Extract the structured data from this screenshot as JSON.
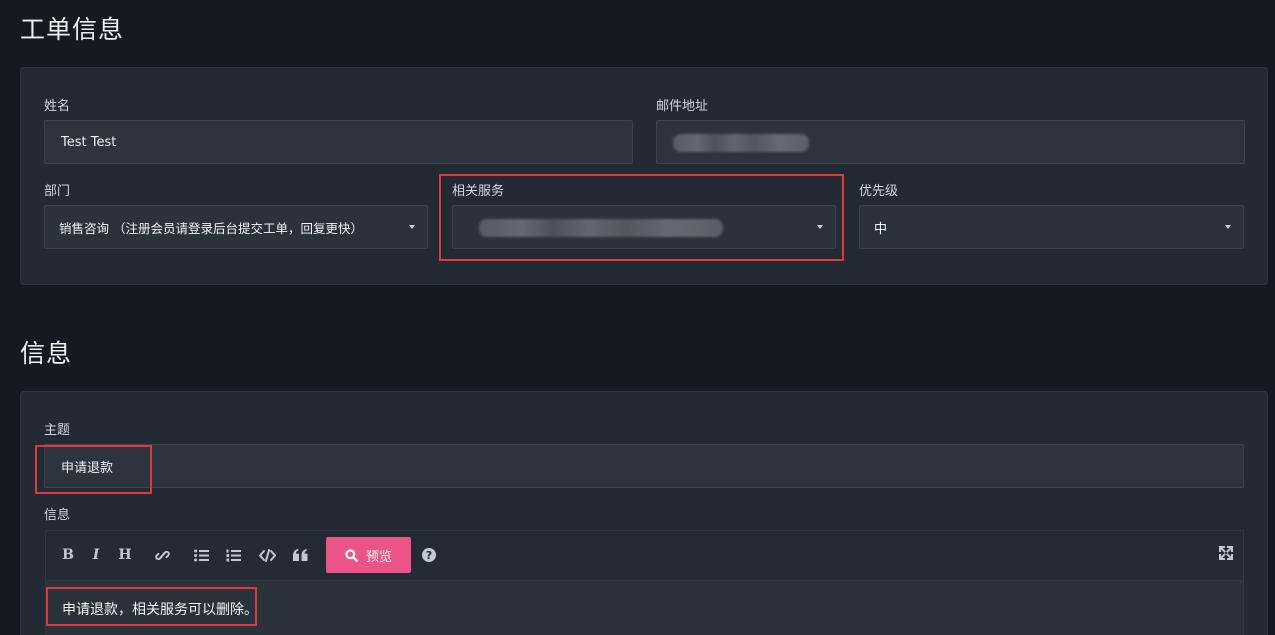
{
  "ticket_section": {
    "title": "工单信息",
    "name": {
      "label": "姓名",
      "value": "Test Test"
    },
    "email": {
      "label": "邮件地址"
    },
    "department": {
      "label": "部门",
      "value": "销售咨询 （注册会员请登录后台提交工单，回复更快）"
    },
    "related_service": {
      "label": "相关服务"
    },
    "priority": {
      "label": "优先级",
      "value": "中"
    }
  },
  "message_section": {
    "title": "信息",
    "subject": {
      "label": "主题",
      "value": "申请退款"
    },
    "message": {
      "label": "信息",
      "value": "申请退款，相关服务可以删除。"
    },
    "toolbar": {
      "bold": "B",
      "italic": "I",
      "heading": "H",
      "preview_label": "预览",
      "help": "?"
    }
  },
  "colors": {
    "background": "#141a22",
    "card": "#222a33",
    "field": "#2c343e",
    "accent_pink": "#ec5386",
    "highlight_red": "#e0393b"
  },
  "icons": [
    "bold-icon",
    "italic-icon",
    "heading-icon",
    "link-icon",
    "unordered-list-icon",
    "ordered-list-icon",
    "code-icon",
    "quote-icon",
    "search-icon",
    "help-icon",
    "fullscreen-icon",
    "caret-down-icon"
  ]
}
